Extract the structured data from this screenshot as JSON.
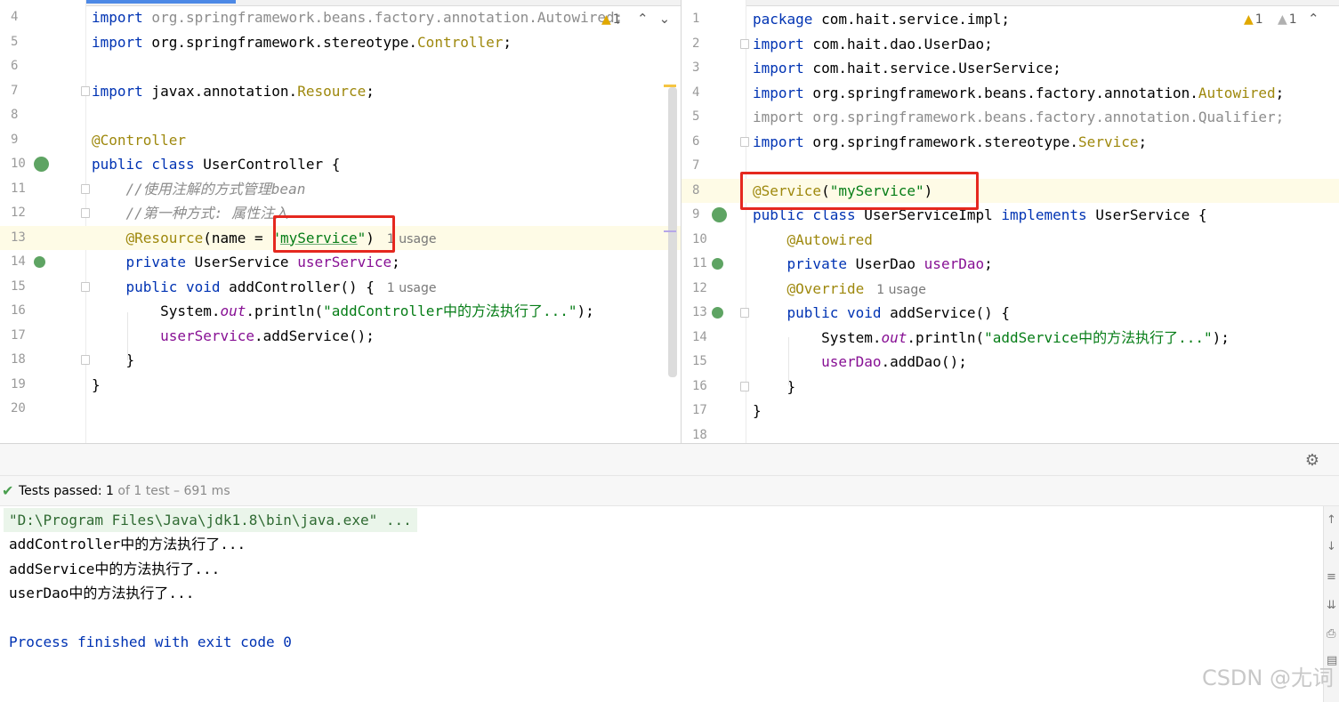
{
  "left_editor": {
    "warning_count": "1",
    "lines": [
      {
        "no": "4",
        "parts": [
          {
            "c": "kw",
            "t": "import"
          },
          {
            "c": "gray",
            "t": " org.springframework.beans.factory.annotation.Autowired;"
          }
        ]
      },
      {
        "no": "5",
        "parts": [
          {
            "c": "kw",
            "t": "import"
          },
          {
            "c": "",
            "t": " org.springframework.stereotype."
          },
          {
            "c": "ann",
            "t": "Controller"
          },
          {
            "c": "",
            "t": ";"
          }
        ]
      },
      {
        "no": "6",
        "parts": []
      },
      {
        "no": "7",
        "parts": [
          {
            "c": "kw",
            "t": "import"
          },
          {
            "c": "",
            "t": " javax.annotation."
          },
          {
            "c": "ann",
            "t": "Resource"
          },
          {
            "c": "",
            "t": ";"
          }
        ]
      },
      {
        "no": "8",
        "parts": []
      },
      {
        "no": "9",
        "parts": [
          {
            "c": "ann",
            "t": "@Controller"
          }
        ]
      },
      {
        "no": "10",
        "parts": [
          {
            "c": "kw",
            "t": "public class"
          },
          {
            "c": "",
            "t": " UserController {"
          }
        ]
      },
      {
        "no": "11",
        "parts": [
          {
            "c": "",
            "t": "    "
          },
          {
            "c": "cmt",
            "t": "//使用注解的方式管理bean"
          }
        ]
      },
      {
        "no": "12",
        "parts": [
          {
            "c": "",
            "t": "    "
          },
          {
            "c": "cmt",
            "t": "//第一种方式: 属性注入"
          }
        ]
      },
      {
        "no": "13",
        "parts": [
          {
            "c": "",
            "t": "    "
          },
          {
            "c": "ann",
            "t": "@Resource"
          },
          {
            "c": "",
            "t": "(name = "
          },
          {
            "c": "str",
            "t": "\""
          },
          {
            "c": "str ul-green",
            "t": "myService"
          },
          {
            "c": "str",
            "t": "\""
          },
          {
            "c": "",
            "t": ")"
          }
        ],
        "usage": "1 usage"
      },
      {
        "no": "14",
        "parts": [
          {
            "c": "",
            "t": "    "
          },
          {
            "c": "kw",
            "t": "private"
          },
          {
            "c": "",
            "t": " UserService "
          },
          {
            "c": "fld",
            "t": "userService"
          },
          {
            "c": "",
            "t": ";"
          }
        ]
      },
      {
        "no": "15",
        "parts": [
          {
            "c": "",
            "t": "    "
          },
          {
            "c": "kw",
            "t": "public void"
          },
          {
            "c": "",
            "t": " addController() {"
          }
        ],
        "usage": "1 usage"
      },
      {
        "no": "16",
        "parts": [
          {
            "c": "",
            "t": "        System."
          },
          {
            "c": "sfld",
            "t": "out"
          },
          {
            "c": "",
            "t": ".println("
          },
          {
            "c": "str",
            "t": "\"addController中的方法执行了...\""
          },
          {
            "c": "",
            "t": ");"
          }
        ]
      },
      {
        "no": "17",
        "parts": [
          {
            "c": "",
            "t": "        "
          },
          {
            "c": "fld",
            "t": "userService"
          },
          {
            "c": "",
            "t": ".addService();"
          }
        ]
      },
      {
        "no": "18",
        "parts": [
          {
            "c": "",
            "t": "    }"
          }
        ]
      },
      {
        "no": "19",
        "parts": [
          {
            "c": "",
            "t": "}"
          }
        ]
      },
      {
        "no": "20",
        "parts": []
      }
    ]
  },
  "right_editor": {
    "warning_count_1": "1",
    "warning_count_2": "1",
    "lines": [
      {
        "no": "1",
        "parts": [
          {
            "c": "kw",
            "t": "package"
          },
          {
            "c": "",
            "t": " com.hait.service.impl;"
          }
        ]
      },
      {
        "no": "2",
        "parts": [
          {
            "c": "kw",
            "t": "import"
          },
          {
            "c": "",
            "t": " com.hait.dao.UserDao;"
          }
        ]
      },
      {
        "no": "3",
        "parts": [
          {
            "c": "kw",
            "t": "import"
          },
          {
            "c": "",
            "t": " com.hait.service.UserService;"
          }
        ]
      },
      {
        "no": "4",
        "parts": [
          {
            "c": "kw",
            "t": "import"
          },
          {
            "c": "",
            "t": " org.springframework.beans.factory.annotation."
          },
          {
            "c": "ann",
            "t": "Autowired"
          },
          {
            "c": "",
            "t": ";"
          }
        ]
      },
      {
        "no": "5",
        "parts": [
          {
            "c": "gray",
            "t": "import org.springframework.beans.factory.annotation.Qualifier;"
          }
        ]
      },
      {
        "no": "6",
        "parts": [
          {
            "c": "kw",
            "t": "import"
          },
          {
            "c": "",
            "t": " org.springframework.stereotype."
          },
          {
            "c": "ann",
            "t": "Service"
          },
          {
            "c": "",
            "t": ";"
          }
        ]
      },
      {
        "no": "7",
        "parts": []
      },
      {
        "no": "8",
        "parts": [
          {
            "c": "ann",
            "t": "@Service"
          },
          {
            "c": "",
            "t": "("
          },
          {
            "c": "str",
            "t": "\"myService\""
          },
          {
            "c": "",
            "t": ")"
          }
        ]
      },
      {
        "no": "9",
        "parts": [
          {
            "c": "kw",
            "t": "public class"
          },
          {
            "c": "",
            "t": " UserServiceImpl "
          },
          {
            "c": "kw",
            "t": "implements"
          },
          {
            "c": "",
            "t": " UserService {"
          }
        ]
      },
      {
        "no": "10",
        "parts": [
          {
            "c": "",
            "t": "    "
          },
          {
            "c": "ann",
            "t": "@Autowired"
          }
        ]
      },
      {
        "no": "11",
        "parts": [
          {
            "c": "",
            "t": "    "
          },
          {
            "c": "kw",
            "t": "private"
          },
          {
            "c": "",
            "t": " UserDao "
          },
          {
            "c": "fld",
            "t": "userDao"
          },
          {
            "c": "",
            "t": ";"
          }
        ]
      },
      {
        "no": "12",
        "parts": [
          {
            "c": "",
            "t": "    "
          },
          {
            "c": "ann",
            "t": "@Override"
          }
        ],
        "usage": "1 usage"
      },
      {
        "no": "13",
        "parts": [
          {
            "c": "",
            "t": "    "
          },
          {
            "c": "kw",
            "t": "public void"
          },
          {
            "c": "",
            "t": " addService() {"
          }
        ]
      },
      {
        "no": "14",
        "parts": [
          {
            "c": "",
            "t": "        System."
          },
          {
            "c": "sfld",
            "t": "out"
          },
          {
            "c": "",
            "t": ".println("
          },
          {
            "c": "str",
            "t": "\"addService中的方法执行了...\""
          },
          {
            "c": "",
            "t": ");"
          }
        ]
      },
      {
        "no": "15",
        "parts": [
          {
            "c": "",
            "t": "        "
          },
          {
            "c": "fld",
            "t": "userDao"
          },
          {
            "c": "",
            "t": ".addDao();"
          }
        ]
      },
      {
        "no": "16",
        "parts": [
          {
            "c": "",
            "t": "    }"
          }
        ]
      },
      {
        "no": "17",
        "parts": [
          {
            "c": "",
            "t": "}"
          }
        ]
      },
      {
        "no": "18",
        "parts": []
      }
    ]
  },
  "run": {
    "tests_label": "Tests passed: ",
    "tests_passed": "1",
    "tests_detail": " of 1 test – 691 ms",
    "console_lines": [
      "\"D:\\Program Files\\Java\\jdk1.8\\bin\\java.exe\" ...",
      "addController中的方法执行了...",
      "addService中的方法执行了...",
      "userDao中的方法执行了...",
      "",
      "Process finished with exit code 0"
    ]
  },
  "watermark": "CSDN @尢词",
  "icons": {
    "warning": "warning-triangle-icon",
    "gear": "gear-icon",
    "check": "check-icon",
    "bean": "spring-bean-icon"
  },
  "colors": {
    "keyword": "#0033b3",
    "string": "#067d17",
    "annotation": "#9e880d",
    "field": "#871094",
    "highlight_box": "#e5281f"
  }
}
